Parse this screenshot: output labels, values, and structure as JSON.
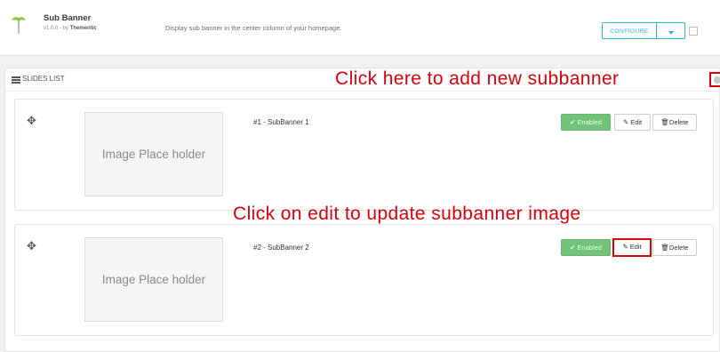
{
  "module": {
    "name": "Sub Banner",
    "version": "v1.0.0 - by",
    "author": "Thementic",
    "description": "Display sub banner in the center column of your homepage.",
    "configure_label": "CONFIGURE",
    "accent_color": "#25b9d7"
  },
  "panel": {
    "title": "SLIDES LIST",
    "add_annotation": "Click here to add new subbanner"
  },
  "edit_annotation": "Click on edit to update subbanner image",
  "annotation_color": "#d9000b",
  "slides": [
    {
      "title": "#1 - SubBanner 1",
      "image_placeholder": "Image Place holder",
      "enabled_label": "Enabled",
      "edit_label": "Edit",
      "delete_label": "Delete"
    },
    {
      "title": "#2 - SubBanner 2",
      "image_placeholder": "Image Place holder",
      "enabled_label": "Enabled",
      "edit_label": "Edit",
      "delete_label": "Delete"
    }
  ],
  "status_color": "#72c279"
}
